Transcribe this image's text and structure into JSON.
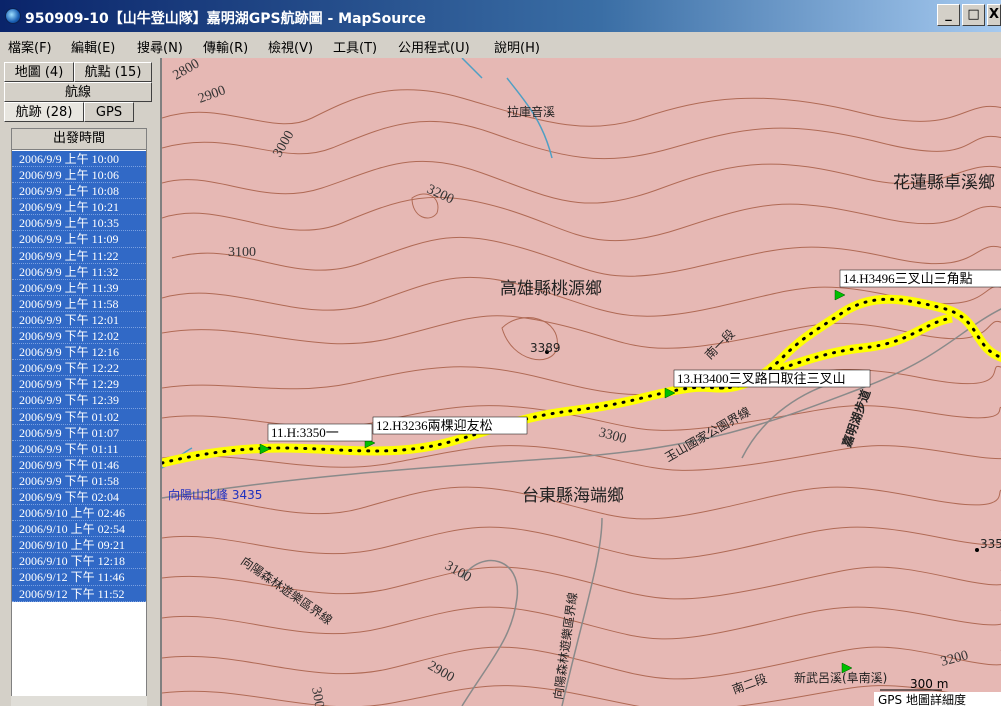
{
  "window": {
    "title": "950909-10【山牛登山隊】嘉明湖GPS航跡圖 - MapSource",
    "min_label": "_",
    "max_label": "□",
    "close_label": "X"
  },
  "menu": [
    "檔案(F)",
    "編輯(E)",
    "搜尋(N)",
    "傳輸(R)",
    "檢視(V)",
    "工具(T)",
    "公用程式(U)",
    "說明(H)"
  ],
  "tabs": {
    "maps": "地圖 (4)",
    "waypoints": "航點 (15)",
    "routes": "航線",
    "tracks": "航跡 (28)",
    "gps": "GPS"
  },
  "track_list": {
    "column_header": "出發時間",
    "rows": [
      "2006/9/9 上午 10:00",
      "2006/9/9 上午 10:06",
      "2006/9/9 上午 10:08",
      "2006/9/9 上午 10:21",
      "2006/9/9 上午 10:35",
      "2006/9/9 上午 11:09",
      "2006/9/9 上午 11:22",
      "2006/9/9 上午 11:32",
      "2006/9/9 上午 11:39",
      "2006/9/9 上午 11:58",
      "2006/9/9 下午 12:01",
      "2006/9/9 下午 12:02",
      "2006/9/9 下午 12:16",
      "2006/9/9 下午 12:22",
      "2006/9/9 下午 12:29",
      "2006/9/9 下午 12:39",
      "2006/9/9 下午 01:02",
      "2006/9/9 下午 01:07",
      "2006/9/9 下午 01:11",
      "2006/9/9 下午 01:46",
      "2006/9/9 下午 01:58",
      "2006/9/9 下午 02:04",
      "2006/9/10 上午 02:46",
      "2006/9/10 上午 02:54",
      "2006/9/10 上午 09:21",
      "2006/9/10 下午 12:18",
      "2006/9/12 下午 11:46",
      "2006/9/12 下午 11:52"
    ]
  },
  "map": {
    "contours": [
      "2800",
      "2900",
      "3000",
      "3200",
      "3100",
      "3300",
      "3100",
      "3000",
      "2900",
      "3200",
      "3389"
    ],
    "places": {
      "lakuyin_creek": "拉庫音溪",
      "hualien_zhuoxi": "花蓮縣卓溪鄉",
      "kaohsiung_taoyuan": "高雄縣桃源鄉",
      "taitung_haiduan": "台東縣海端鄉",
      "xiangyang_north_peak": "向陽山北峰 3435",
      "south_section_1": "南一段",
      "south_section_2": "南二段",
      "yushan_boundary": "玉山國家公園界線",
      "jiaming_trail": "嘉明湖步道",
      "forest_boundary_1": "向陽森林遊樂區界線",
      "forest_boundary_2": "向陽森林遊樂區界線",
      "xinwu_creek": "新武呂溪(阜南溪)",
      "elev_335": "335"
    },
    "waypoints": {
      "wp11": "11.H:3350一",
      "wp12": "12.H3236兩棵迎友松",
      "wp13": "13.H3400三叉路口取往三叉山",
      "wp14": "14.H3496三叉山三角點"
    },
    "scale": "300 m",
    "detail_label": "GPS 地圖詳細度",
    "colors": {
      "background": "#e6b8b4",
      "contour": "#b06a55",
      "track": "#ffff00",
      "waypoint_flag": "#00c000",
      "water": "#4f9fc4"
    }
  }
}
